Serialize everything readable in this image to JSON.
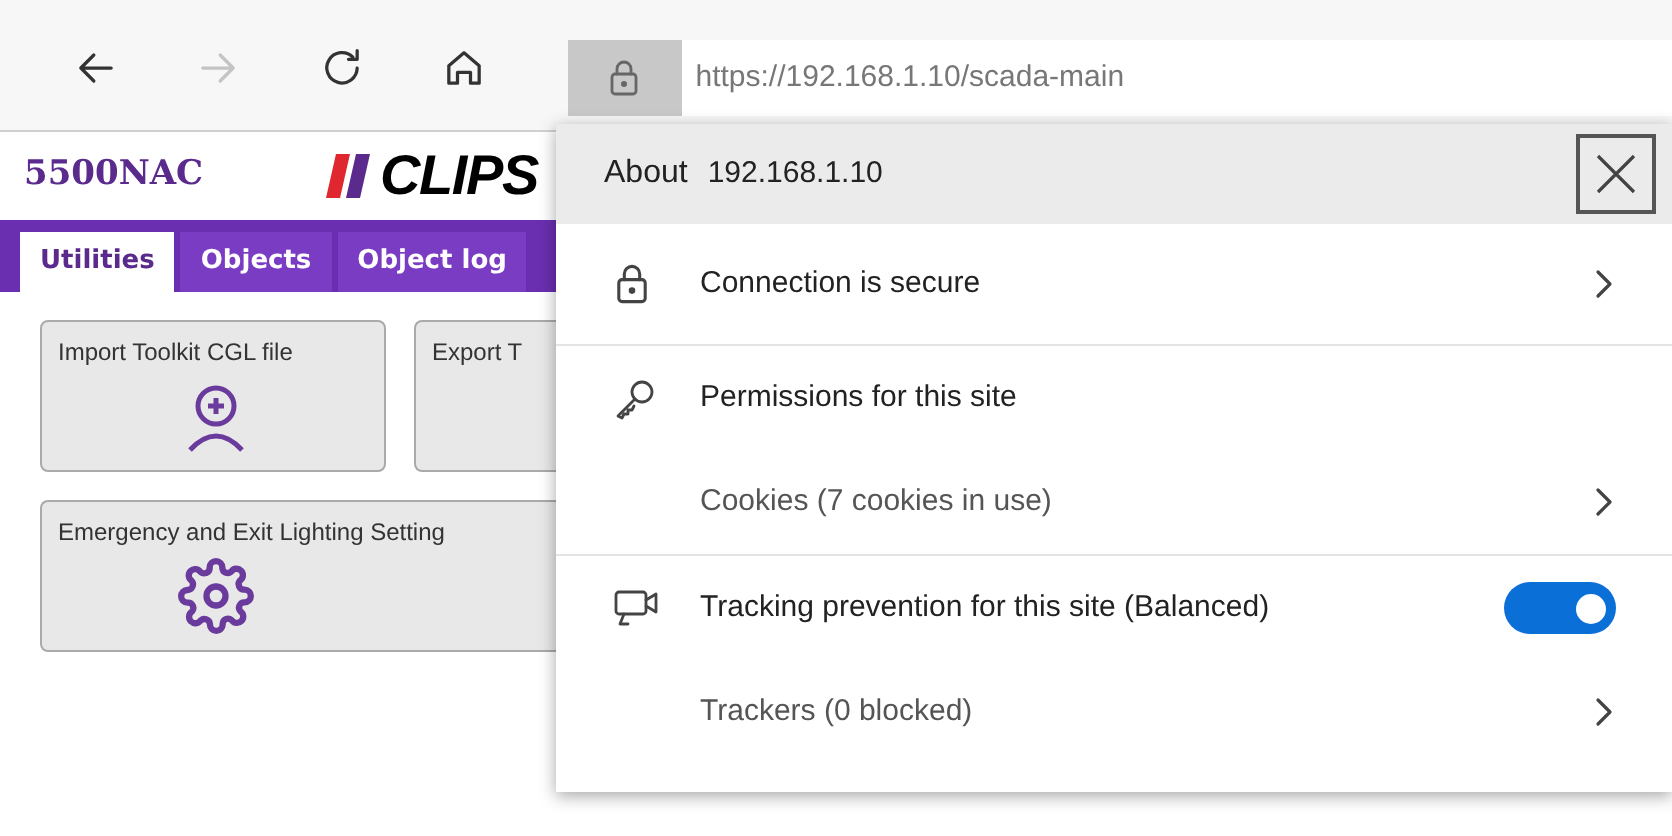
{
  "toolbar": {
    "buttons": [
      {
        "kind": "back",
        "disabled": false
      },
      {
        "kind": "forward",
        "disabled": true
      },
      {
        "kind": "reload",
        "disabled": false
      },
      {
        "kind": "home",
        "disabled": false
      }
    ],
    "url": "https://192.168.1.10/scada-main"
  },
  "page": {
    "brand": "5500NAC",
    "logo_text": "CLIPS",
    "tabs": [
      {
        "label": "Utilities",
        "selected": true
      },
      {
        "label": "Objects",
        "selected": false
      },
      {
        "label": "Object log",
        "selected": false
      }
    ],
    "tools": [
      {
        "label": "Import Toolkit CGL file",
        "kind": "import"
      },
      {
        "label": "Export T",
        "kind": "export"
      },
      {
        "label": "Emergency and Exit Lighting Setting",
        "kind": "settings"
      }
    ]
  },
  "site_info": {
    "title": "About",
    "host": "192.168.1.10",
    "groups": [
      [
        {
          "kind": "nav",
          "label": "Connection is secure"
        }
      ],
      [
        {
          "kind": "heading",
          "label": "Permissions for this site"
        },
        {
          "kind": "sub",
          "label": "Cookies (7 cookies in use)"
        }
      ],
      [
        {
          "kind": "toggle",
          "label": "Tracking prevention for this site (Balanced)",
          "on": true
        },
        {
          "kind": "sub",
          "label": "Trackers (0 blocked)"
        }
      ]
    ]
  }
}
